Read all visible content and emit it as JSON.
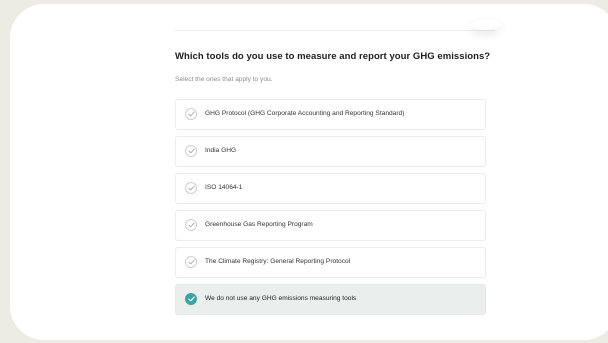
{
  "question": {
    "title": "Which tools do you use to measure and report your GHG emissions?",
    "hint": "Select the ones that apply to you."
  },
  "options": [
    {
      "label": "GHG Protocol (GHG Corporate Accounting and Reporting Standard)",
      "selected": false,
      "icon": "check-icon"
    },
    {
      "label": "India GHG",
      "selected": false,
      "icon": "check-icon"
    },
    {
      "label": "ISO 14064-1",
      "selected": false,
      "icon": "check-icon"
    },
    {
      "label": "Greenhouse Gas Reporting Program",
      "selected": false,
      "icon": "check-icon"
    },
    {
      "label": "The Climate Registry: General Reporting Protocol",
      "selected": false,
      "icon": "check-icon"
    },
    {
      "label": "We do not use any GHG emissions measuring tools",
      "selected": true,
      "icon": "check-icon"
    }
  ],
  "colors": {
    "accent": "#3aa4a0",
    "selected_background": "#eaeeec",
    "page_background": "#ecebe4"
  }
}
